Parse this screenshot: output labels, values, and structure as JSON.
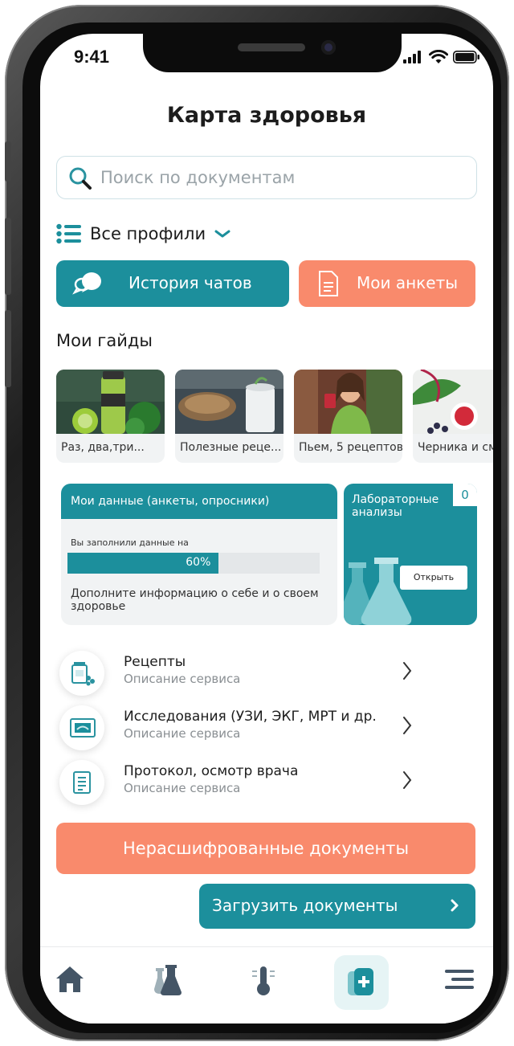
{
  "status": {
    "time": "9:41"
  },
  "page": {
    "title": "Карта здоровья"
  },
  "search": {
    "placeholder": "Поиск по документам"
  },
  "profiles": {
    "label": "Все профили"
  },
  "actions": {
    "chats_label": "История чатов",
    "forms_label": "Мои анкеты"
  },
  "guides": {
    "title": "Мои гайды",
    "items": [
      {
        "label": "Раз, два,три..."
      },
      {
        "label": "Полезные реце..."
      },
      {
        "label": "Пьем, 5 рецептов"
      },
      {
        "label": "Черника и см"
      }
    ]
  },
  "my_data": {
    "title": "Мои данные (анкеты, опросники)",
    "filled_label": "Вы заполнили данные на",
    "progress": 60,
    "progress_text": "60%",
    "hint": "Дополните информацию о себе и о своем здоровье"
  },
  "lab": {
    "title": "Лабораторные анализы",
    "count": "0",
    "open_label": "Открыть"
  },
  "services": [
    {
      "title": "Рецепты",
      "desc": "Описание сервиса",
      "icon": "prescription-icon"
    },
    {
      "title": "Исследования (УЗИ, ЭКГ, МРТ и др.",
      "desc": "Описание сервиса",
      "icon": "research-icon"
    },
    {
      "title": "Протокол, осмотр врача",
      "desc": "Описание сервиса",
      "icon": "protocol-icon"
    }
  ],
  "undeciphered": {
    "label": "Нерасшифрованные документы"
  },
  "upload": {
    "label": "Загрузить документы"
  },
  "tabbar": {
    "items": [
      {
        "icon": "home-icon"
      },
      {
        "icon": "lab-flask-icon"
      },
      {
        "icon": "thermometer-icon"
      },
      {
        "icon": "health-card-icon"
      },
      {
        "icon": "menu-icon"
      }
    ]
  },
  "colors": {
    "teal": "#1c8f9c",
    "coral": "#f98a6c",
    "card_bg": "#f1f3f4"
  }
}
